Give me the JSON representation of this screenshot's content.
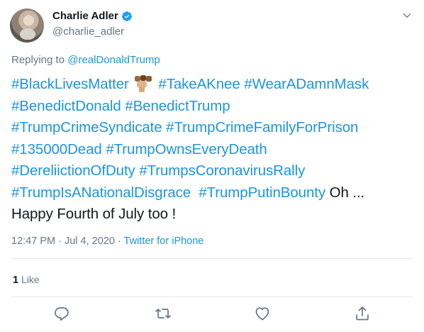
{
  "author": {
    "display_name": "Charlie Adler",
    "handle": "@charlie_adler"
  },
  "reply": {
    "prefix": "Replying to ",
    "mention": "@realDonaldTrump"
  },
  "tweet": {
    "line1": [
      "#BlackLivesMatter",
      "#TakeAKnee",
      "#WearADamnMask"
    ],
    "line2": [
      "#BenedictDonald",
      "#BenedictTrump"
    ],
    "line3": [
      "#TrumpCrimeSyndicate",
      "#TrumpCrimeFamilyForPrison"
    ],
    "line4": [
      "#135000Dead",
      "#TrumpOwnsEveryDeath"
    ],
    "line5": [
      "#DereliictionOfDuty",
      "#TrumpsCoronavirusRally"
    ],
    "line6_tags": [
      "#TrumpIsANationalDisgrace",
      "#TrumpPutinBounty"
    ],
    "line6_tail": "Oh ...",
    "line7": "Happy Fourth of July too !"
  },
  "meta": {
    "time": "12:47 PM",
    "separator": " · ",
    "date": "Jul 4, 2020",
    "source": "Twitter for iPhone"
  },
  "engagement": {
    "like_count": "1",
    "like_label": "Like"
  },
  "icons": {
    "verified": "verified-badge-icon",
    "caret": "chevron-down-icon",
    "reply": "reply-icon",
    "retweet": "retweet-icon",
    "like": "heart-icon",
    "share": "share-icon",
    "emoji": "raised-fists-emoji"
  },
  "colors": {
    "link": "#1b95e0",
    "secondary": "#657786",
    "verified": "#1da1f2"
  }
}
